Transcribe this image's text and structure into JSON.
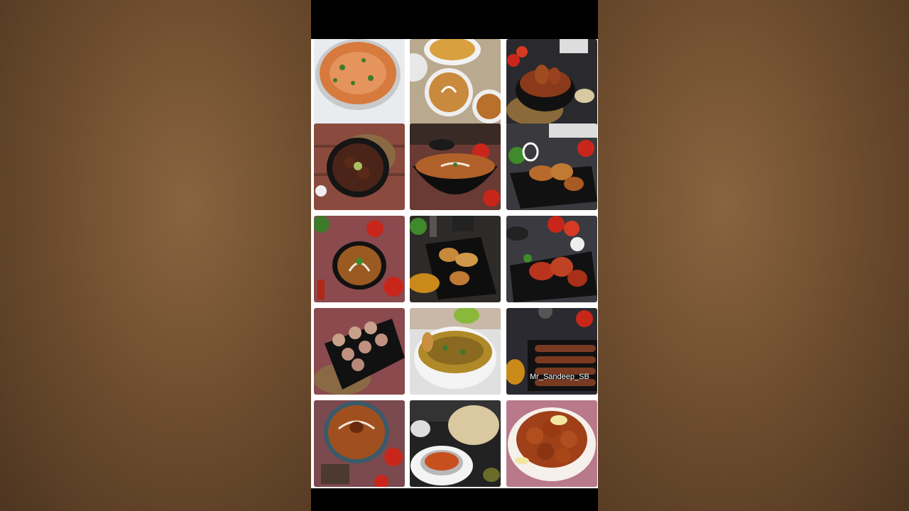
{
  "player": {
    "watermark": "Mr_Sandeep_SB"
  },
  "gallery": {
    "dishes": [
      {
        "icon": "curry-bowl-icon",
        "accent": "#d77a3e"
      },
      {
        "icon": "dal-plate-icon",
        "accent": "#c98a3d"
      },
      {
        "icon": "chicken-bowl-icon",
        "accent": "#8a3a1a"
      },
      {
        "icon": "dry-chicken-bowl-icon",
        "accent": "#5a2a18"
      },
      {
        "icon": "gravy-bowl-icon",
        "accent": "#b0612a"
      },
      {
        "icon": "fried-chicken-tray-icon",
        "accent": "#b86a2a"
      },
      {
        "icon": "dal-makhani-icon",
        "accent": "#9a5a22"
      },
      {
        "icon": "roast-chicken-icon",
        "accent": "#c88a3a"
      },
      {
        "icon": "tandoori-chicken-icon",
        "accent": "#b8341c"
      },
      {
        "icon": "malai-tikka-icon",
        "accent": "#c9a08a"
      },
      {
        "icon": "keema-curry-icon",
        "accent": "#8a6a20"
      },
      {
        "icon": "seekh-kebab-icon",
        "accent": "#7a3a22"
      },
      {
        "icon": "butter-curry-icon",
        "accent": "#a0501e"
      },
      {
        "icon": "thali-icon",
        "accent": "#c8501e"
      },
      {
        "icon": "chicken-pakora-icon",
        "accent": "#a04018"
      }
    ]
  }
}
